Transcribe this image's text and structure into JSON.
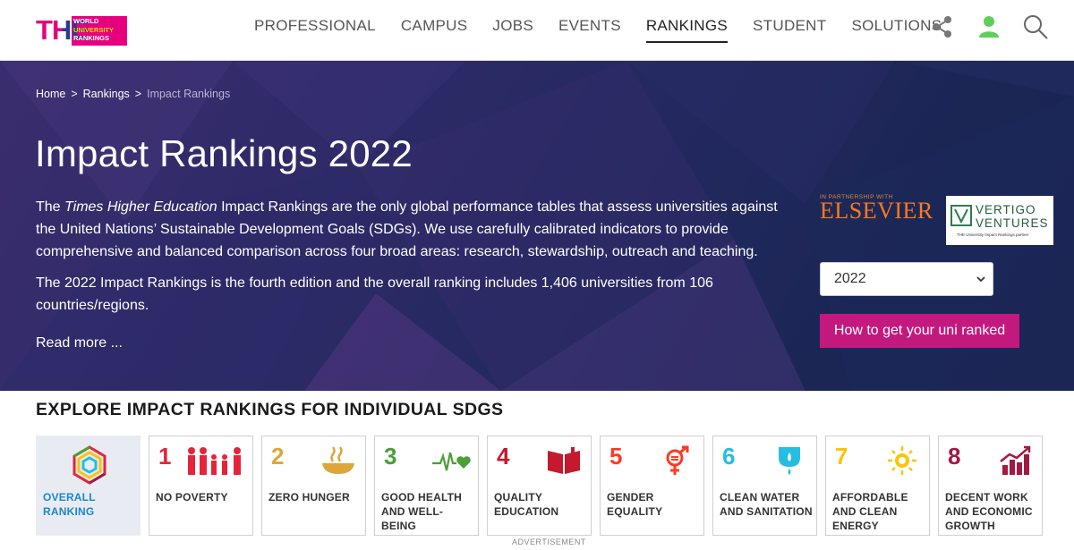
{
  "logo": {
    "mark": "THE",
    "lines": [
      "World",
      "University",
      "Rankings"
    ]
  },
  "nav": {
    "items": [
      {
        "label": "PROFESSIONAL"
      },
      {
        "label": "CAMPUS"
      },
      {
        "label": "JOBS"
      },
      {
        "label": "EVENTS"
      },
      {
        "label": "RANKINGS",
        "active": true
      },
      {
        "label": "STUDENT"
      },
      {
        "label": "SOLUTIONS"
      }
    ],
    "icons": [
      "share-icon",
      "user-icon",
      "search-icon"
    ]
  },
  "breadcrumb": {
    "home": "Home",
    "sep1": ">",
    "rankings": "Rankings",
    "sep2": ">",
    "current": "Impact Rankings"
  },
  "hero": {
    "title": "Impact Rankings 2022",
    "p1_em": "Times Higher Education",
    "p1_pre": "The ",
    "p1_post": " Impact Rankings are the only global performance tables that assess universities against the United Nations’ Sustainable Development Goals (SDGs). We use carefully calibrated indicators to provide comprehensive and balanced comparison across four broad areas: research, stewardship, outreach and teaching.",
    "p2": "The 2022 Impact Rankings is the fourth edition and the overall ranking includes 1,406 universities from 106 countries/regions.",
    "read_more": "Read more ...",
    "partner_tag": "In partnership with",
    "partner_name": "ELSEVIER",
    "vertigo_line1": "VERTIGO",
    "vertigo_line2": "VENTURES",
    "vertigo_sub": "THE University Impact Rankings partner",
    "year_value": "2022",
    "rank_button": "How to get your uni ranked"
  },
  "sdg": {
    "heading": "EXPLORE IMPACT RANKINGS FOR INDIVIDUAL SDGS",
    "tiles": [
      {
        "num": "",
        "label": "OVERALL RANKING",
        "icon": "overall-ranking-icon",
        "color": "#1e86c8"
      },
      {
        "num": "1",
        "label": "NO POVERTY",
        "icon": "people-icon",
        "color": "#e5243b"
      },
      {
        "num": "2",
        "label": "ZERO HUNGER",
        "icon": "bowl-icon",
        "color": "#dda63a"
      },
      {
        "num": "3",
        "label": "GOOD HEALTH AND WELL-BEING",
        "icon": "heartbeat-icon",
        "color": "#4c9f38"
      },
      {
        "num": "4",
        "label": "QUALITY EDUCATION",
        "icon": "book-icon",
        "color": "#c5192d"
      },
      {
        "num": "5",
        "label": "GENDER EQUALITY",
        "icon": "gender-icon",
        "color": "#ff3a21"
      },
      {
        "num": "6",
        "label": "CLEAN WATER AND SANITATION",
        "icon": "water-drop-icon",
        "color": "#26bde2"
      },
      {
        "num": "7",
        "label": "AFFORDABLE AND CLEAN ENERGY",
        "icon": "sun-icon",
        "color": "#fcc30b"
      },
      {
        "num": "8",
        "label": "DECENT WORK AND ECONOMIC GROWTH",
        "icon": "growth-chart-icon",
        "color": "#a21942"
      }
    ]
  },
  "ad_label": "ADVERTISEMENT"
}
